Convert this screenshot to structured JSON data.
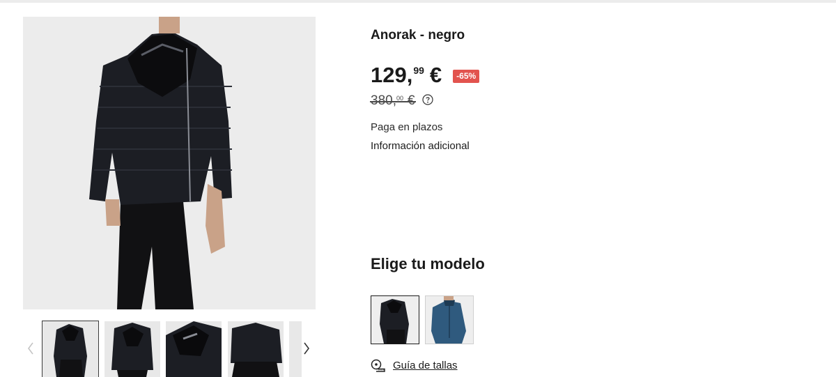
{
  "product": {
    "title": "Anorak - negro",
    "price": {
      "integer": "129,",
      "decimals": "99",
      "currency": "€"
    },
    "discount_badge": "-65%",
    "old_price": {
      "integer": "380,",
      "decimals": "00",
      "currency": "€"
    },
    "installments_label": "Paga en plazos",
    "additional_info_label": "Información adicional"
  },
  "models": {
    "heading": "Elige tu modelo",
    "options": [
      {
        "color": "negro",
        "swatch": "#1c1e24"
      },
      {
        "color": "azul",
        "swatch": "#2f5a7e"
      }
    ]
  },
  "size_guide": {
    "label": "Guía de tallas"
  },
  "gallery": {
    "thumbnail_count_visible": 5,
    "active_index": 0
  },
  "colors": {
    "discount_badge": "#e2534e",
    "jacket": "#1c1e24",
    "background": "#ececec"
  }
}
